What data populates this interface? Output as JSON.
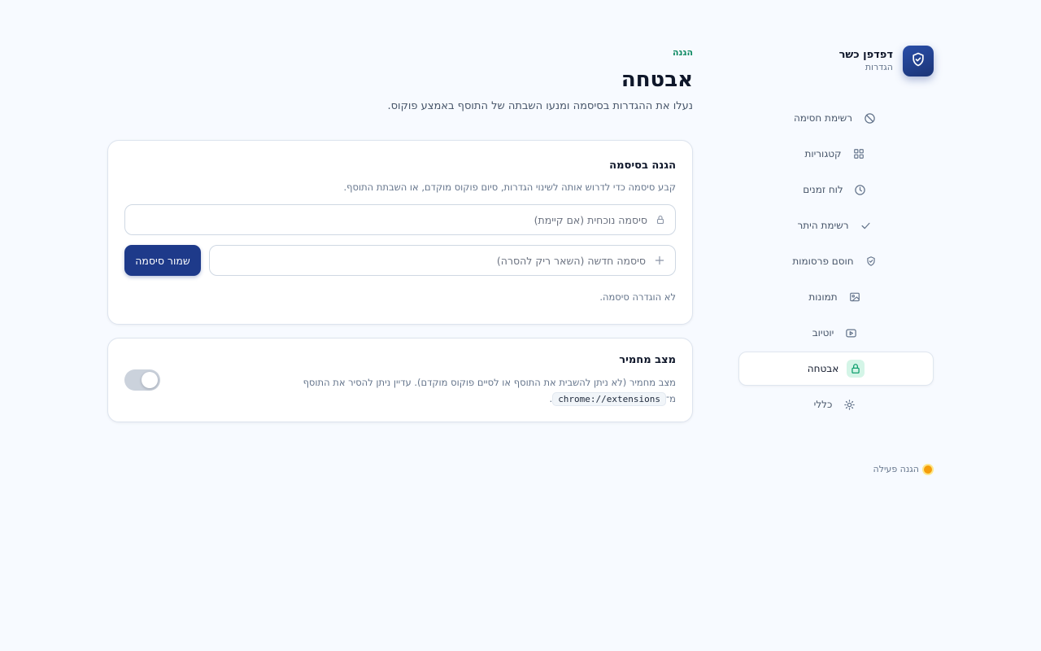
{
  "brand": {
    "title": "דפדפן כשר",
    "subtitle": "הגדרות",
    "logo_icon": "shield-check-icon",
    "logo_color": "#1e3a8a"
  },
  "sidebar": {
    "items": [
      {
        "label": "רשימת חסימה",
        "icon": "block-icon",
        "active": false
      },
      {
        "label": "קטגוריות",
        "icon": "grid-icon",
        "active": false
      },
      {
        "label": "לוח זמנים",
        "icon": "clock-icon",
        "active": false
      },
      {
        "label": "רשימת היתר",
        "icon": "check-icon",
        "active": false
      },
      {
        "label": "חוסם פרסומות",
        "icon": "shield-icon",
        "active": false
      },
      {
        "label": "תמונות",
        "icon": "image-icon",
        "active": false
      },
      {
        "label": "יוטיוב",
        "icon": "youtube-icon",
        "active": false
      },
      {
        "label": "אבטחה",
        "icon": "lock-icon",
        "active": true
      },
      {
        "label": "כללי",
        "icon": "sun-icon",
        "active": false
      }
    ],
    "status": {
      "label": "הגנה פעילה",
      "color": "#f59e0b"
    }
  },
  "main": {
    "eyebrow": "הגנה",
    "title": "אבטחה",
    "description": "נעלו את ההגדרות בסיסמה ומנעו השבתה של התוסף באמצע פוקוס.",
    "password_card": {
      "title": "הגנה בסיסמה",
      "description": "קבע סיסמה כדי לדרוש אותה לשינוי הגדרות, סיום פוקוס מוקדם, או השבתת התוסף.",
      "current_placeholder": "סיסמה נוכחית (אם קיימת)",
      "current_value": "",
      "new_placeholder": "סיסמה חדשה (השאר ריק להסרה)",
      "new_value": "",
      "save_label": "שמור סיסמה",
      "note": "לא הוגדרה סיסמה."
    },
    "strict_card": {
      "title": "מצב מחמיר",
      "description_before": "מצב מחמיר (לא ניתן להשבית את התוסף או לסיים פוקוס מוקדם). עדיין ניתן להסיר את התוסף מ־",
      "code": "chrome://extensions",
      "description_after": ".",
      "enabled": false
    }
  },
  "colors": {
    "accent": "#1e3a8a",
    "active_icon_bg": "#d4f5e7",
    "active_icon": "#0f9f6e",
    "eyebrow": "#0f8a63"
  }
}
